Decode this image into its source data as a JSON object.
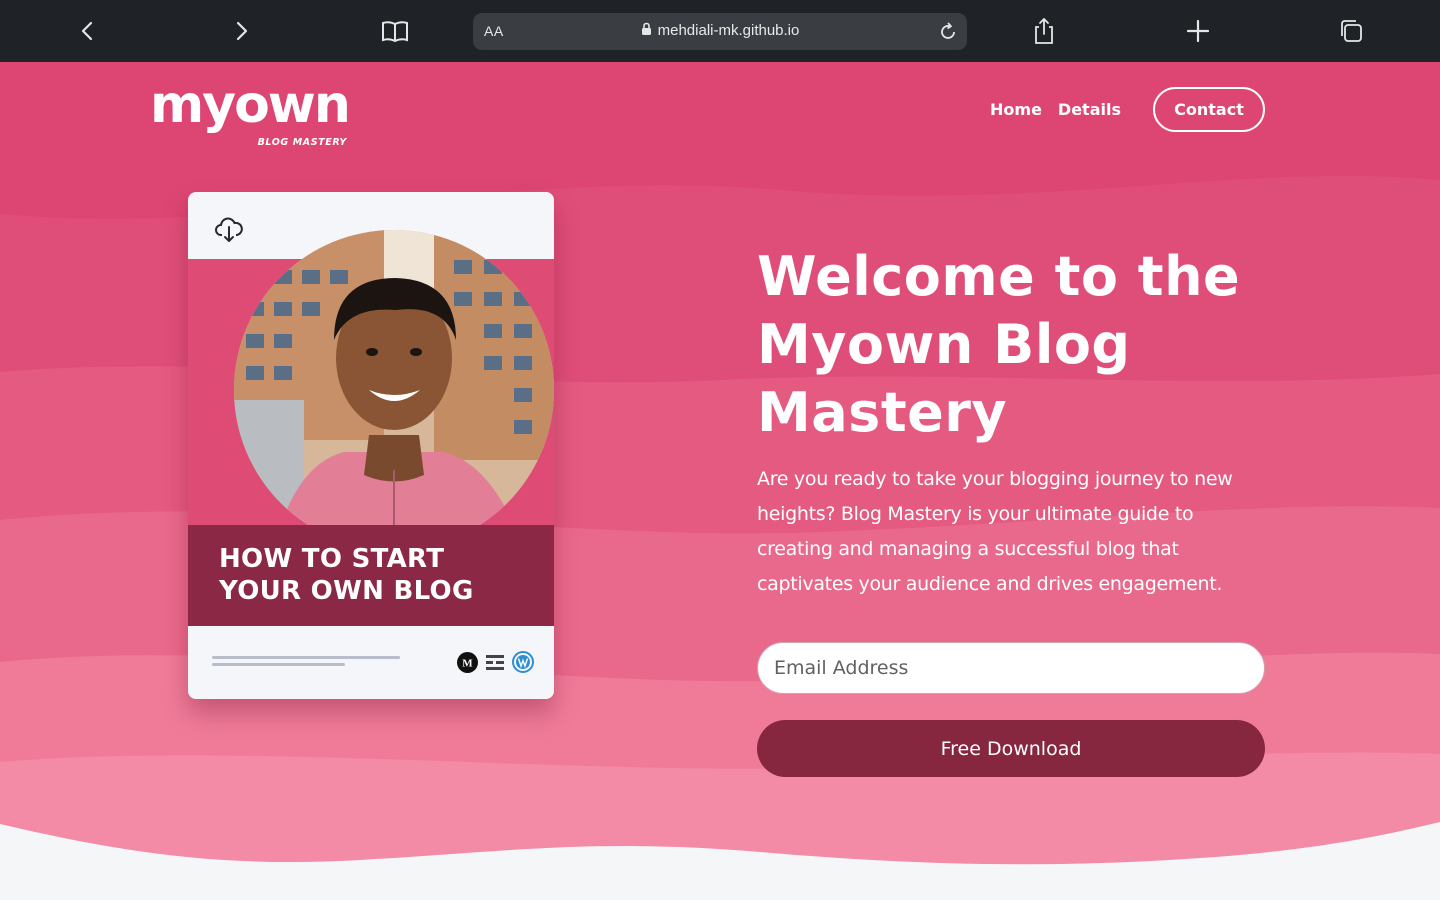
{
  "browser": {
    "url": "mehdiali-mk.github.io",
    "text_size_label": "AA",
    "icons": [
      "back-icon",
      "forward-icon",
      "reader-book-icon",
      "lock-icon",
      "reload-icon",
      "share-icon",
      "new-tab-plus-icon",
      "tabs-overview-icon"
    ]
  },
  "site": {
    "logo": {
      "word": "myown",
      "tagline": "BLOG MASTERY"
    },
    "nav": {
      "home": "Home",
      "details": "Details",
      "contact": "Contact"
    }
  },
  "book": {
    "title_line1": "HOW TO START",
    "title_line2": "YOUR OWN BLOG",
    "icons": [
      "cloud-download-icon",
      "medium-icon",
      "substack-icon",
      "wordpress-icon"
    ],
    "medium_letter": "M"
  },
  "hero": {
    "headline_line1": "Welcome to the",
    "headline_line2": "Myown Blog",
    "headline_line3": "Mastery",
    "description": "Are you ready to take your blogging journey to new heights? Blog Mastery is your ultimate guide to creating and managing a successful blog that captivates your audience and drives engagement.",
    "email_placeholder": "Email Address",
    "cta": "Free Download"
  },
  "colors": {
    "chrome": "#1f2327",
    "hero_top": "#dd4672",
    "wave_mid": "#e9698c",
    "wave_light": "#f38aa6",
    "title_box": "#8a2845",
    "cta": "#86263f",
    "page_bg": "#f5f6f8"
  }
}
